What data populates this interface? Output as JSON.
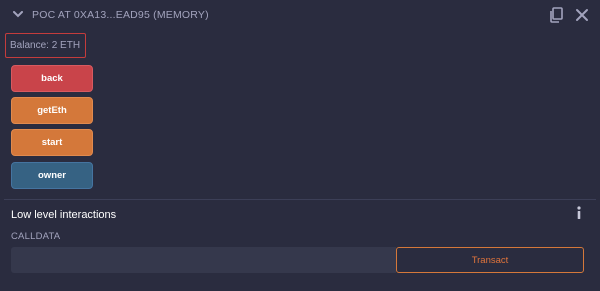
{
  "header": {
    "title": "POC AT 0XA13...EAD95 (MEMORY)",
    "chevron_icon": "chevron-down-icon",
    "copy_icon": "copy-icon",
    "close_icon": "close-icon"
  },
  "balance": {
    "text": "Balance: 2 ETH"
  },
  "functions": [
    {
      "label": "back",
      "color": "#c9444a"
    },
    {
      "label": "getEth",
      "color": "#d4783a"
    },
    {
      "label": "start",
      "color": "#d4783a"
    },
    {
      "label": "owner",
      "color": "#366283"
    }
  ],
  "low_level": {
    "title": "Low level interactions",
    "info_icon": "info-icon",
    "calldata_label": "CALLDATA",
    "calldata_value": "",
    "transact_label": "Transact"
  },
  "colors": {
    "background": "#2a2c3f",
    "text_muted": "#a2a3bd",
    "accent_orange": "#d4783a",
    "accent_red": "#c43c3c"
  }
}
